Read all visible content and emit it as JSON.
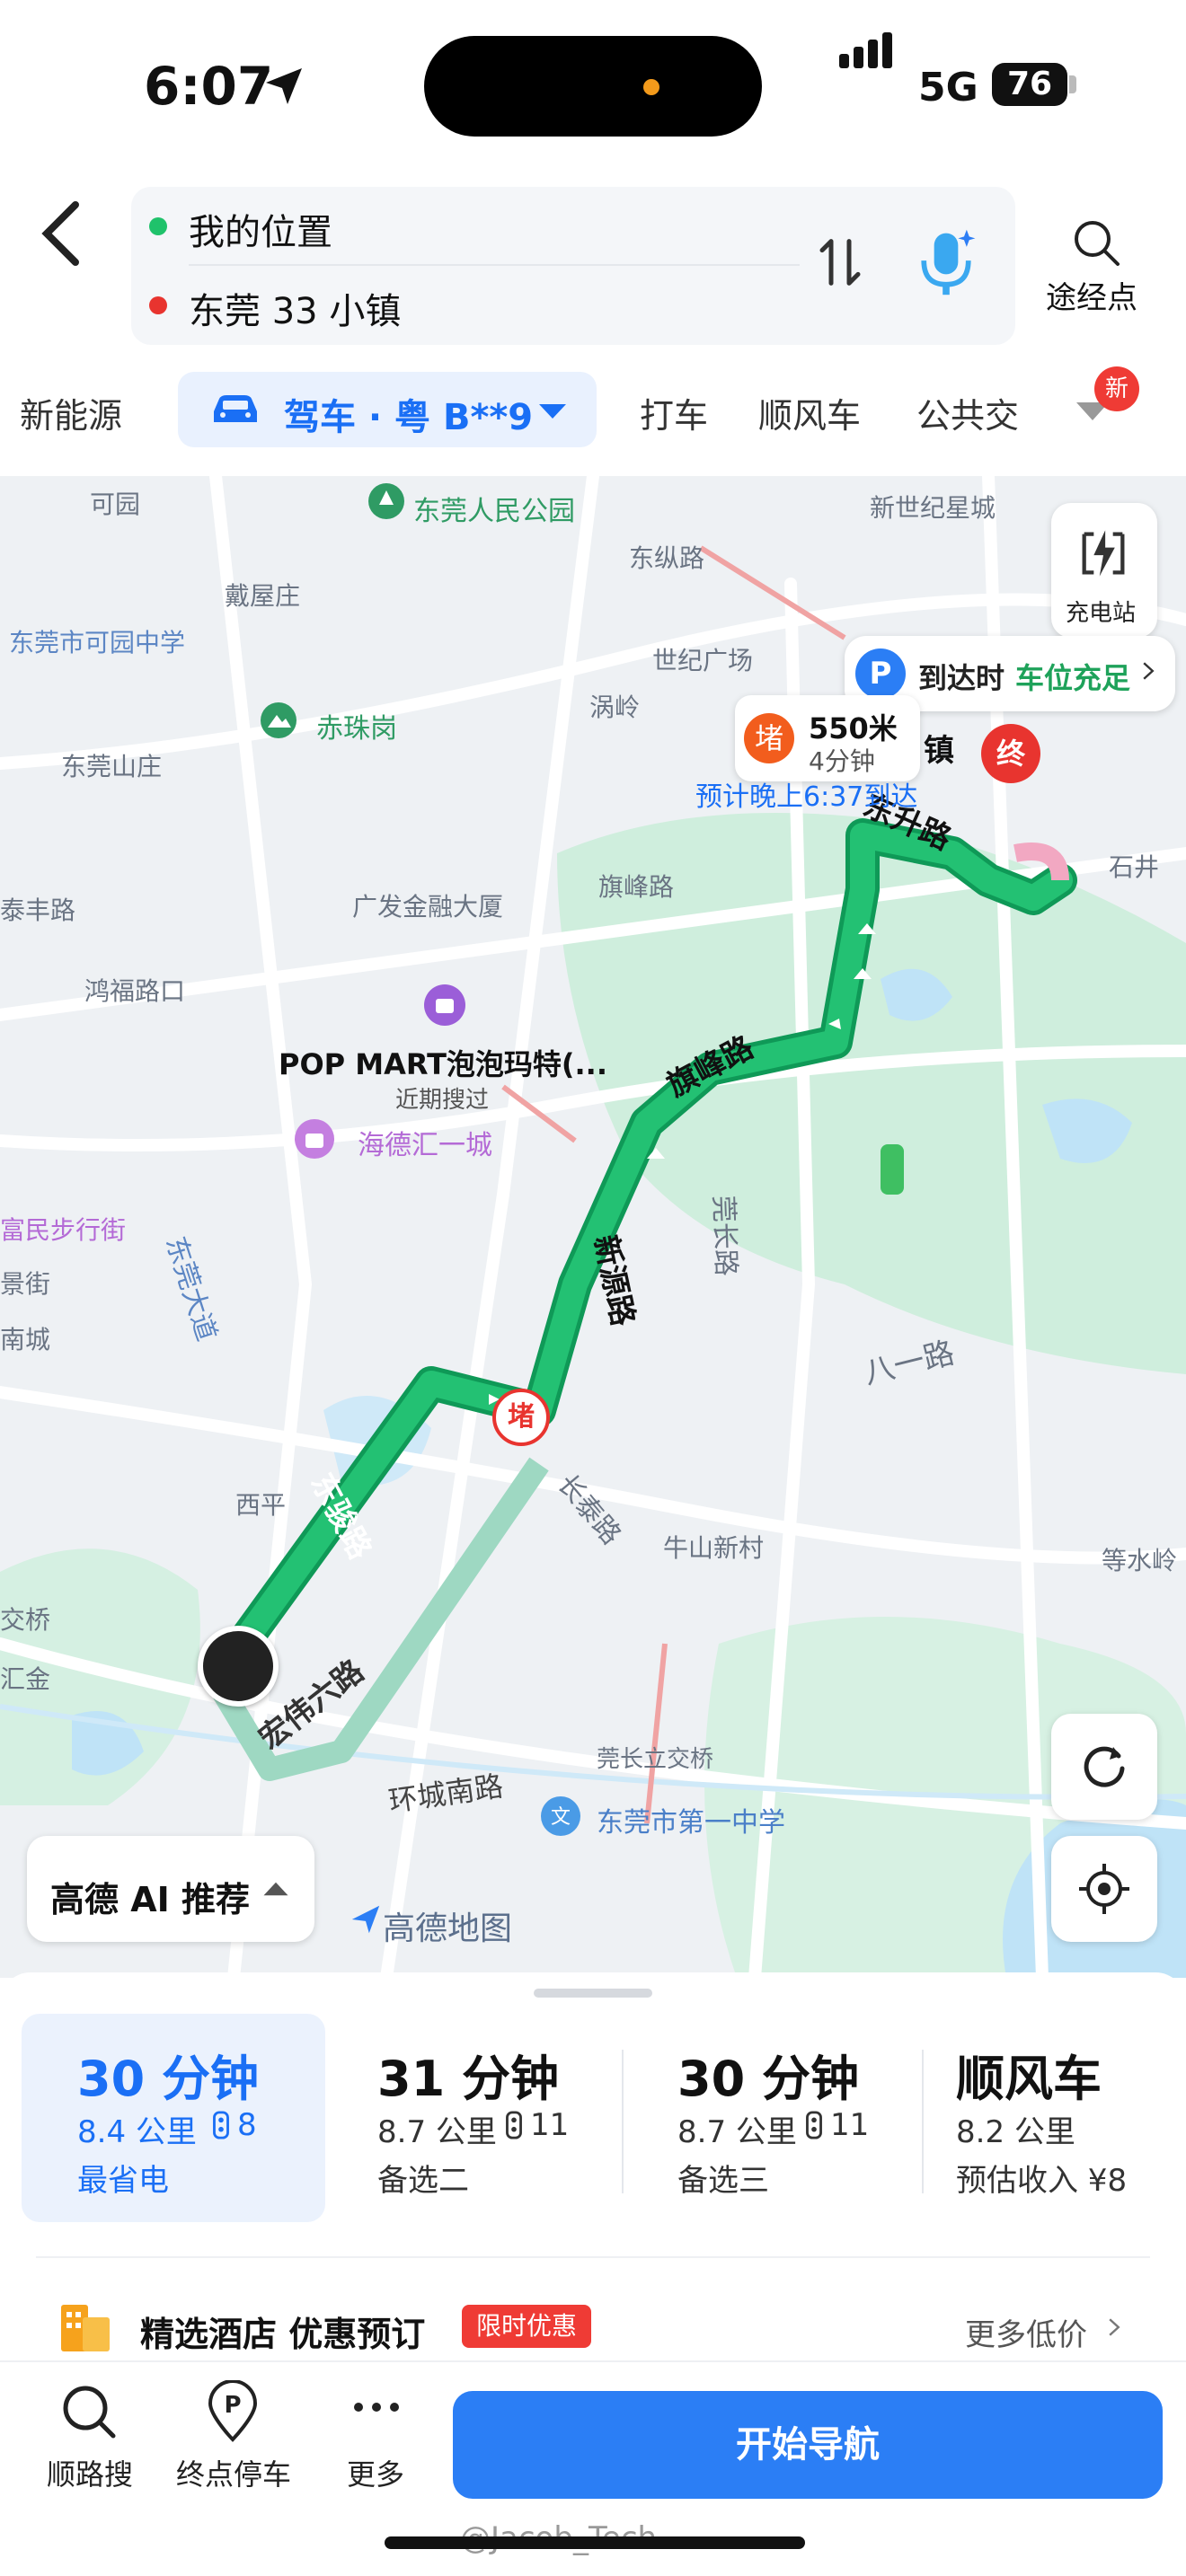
{
  "status": {
    "time": "6:07",
    "network": "5G",
    "battery": "76"
  },
  "header": {
    "origin": "我的位置",
    "destination": "东莞 33 小镇",
    "waypoint_label": "途经点"
  },
  "modes": {
    "new_energy": "新能源",
    "drive": "驾车 · 粤 B**9",
    "taxi": "打车",
    "carpool": "顺风车",
    "transit": "公共交",
    "new_badge": "新"
  },
  "map": {
    "places": [
      "东莞人民公园",
      "可园",
      "戴屋庄",
      "东纵路",
      "新世纪星城",
      "东莞市可园中学",
      "世纪广场",
      "涡岭",
      "赤珠岗",
      "东莞山庄",
      "广发金融大厦",
      "旗峰路",
      "鸿福路口",
      "POP MART泡泡玛特(...",
      "近期搜过",
      "海德汇一城",
      "石井",
      "东莞大道",
      "莞长路",
      "八一路",
      "西平",
      "长泰路",
      "牛山新村",
      "等水岭",
      "环城南路",
      "莞长立交桥",
      "东莞市第一中学",
      "富民步行街",
      "景街",
      "南城",
      "泰丰路",
      "交桥",
      "汇金",
      "镇"
    ],
    "roads": [
      "东骏路",
      "新源路",
      "旗峰路",
      "东升路",
      "宏伟六路"
    ],
    "charge_label": "充电站",
    "parking_text": "到达时",
    "parking_highlight": "车位充足",
    "jam_badge": "堵",
    "jam_distance": "550米",
    "jam_time": "4分钟",
    "eta": "预计晚上6:37到达",
    "end_marker": "终",
    "ai_label": "高德 AI 推荐",
    "brand": "高德地图"
  },
  "routes": [
    {
      "time": "30 分钟",
      "distance": "8.4 公里",
      "lights": "8",
      "tag": "最省电"
    },
    {
      "time": "31 分钟",
      "distance": "8.7 公里",
      "lights": "11",
      "tag": "备选二"
    },
    {
      "time": "30 分钟",
      "distance": "8.7 公里",
      "lights": "11",
      "tag": "备选三"
    },
    {
      "time": "顺风车",
      "distance": "8.2 公里",
      "lights": "",
      "tag": "预估收入 ¥8"
    }
  ],
  "hotel": {
    "title": "精选酒店 优惠预订",
    "badge": "限时优惠",
    "more": "更多低价"
  },
  "footer": {
    "search": "顺路搜",
    "parking": "终点停车",
    "more": "更多",
    "start": "开始导航"
  },
  "watermark": "@Jacob_Tech",
  "colors": {
    "accent": "#2b7ef5",
    "route": "#17b36b",
    "jam": "#e8342f"
  }
}
